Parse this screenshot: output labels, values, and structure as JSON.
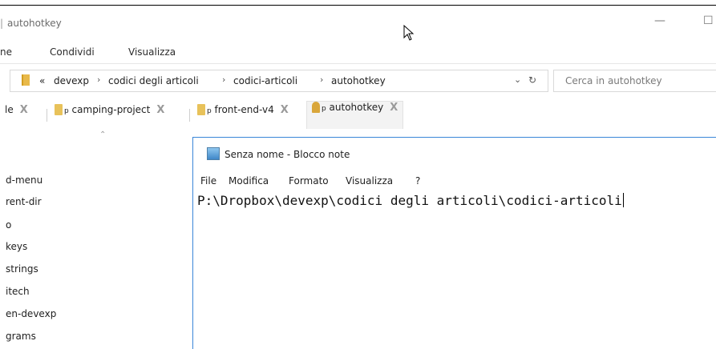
{
  "window": {
    "title": "autohotkey",
    "minimize_icon": "minimize-icon",
    "maximize_icon": "maximize-icon"
  },
  "ribbon": {
    "tabs": [
      "ne",
      "Condividi",
      "Visualizza"
    ]
  },
  "address_bar": {
    "back_glyph": "«",
    "crumbs": [
      "devexp",
      "codici degli articoli",
      "codici-articoli",
      "autohotkey"
    ],
    "dropdown_icon": "chevron-down-icon",
    "refresh_icon": "refresh-icon"
  },
  "search": {
    "placeholder": "Cerca in autohotkey"
  },
  "tabs": [
    {
      "label": "le",
      "close": "X"
    },
    {
      "label": "camping-project",
      "prefix": "p",
      "close": "X"
    },
    {
      "label": "front-end-v4",
      "prefix": "p",
      "close": "X"
    },
    {
      "label": "autohotkey",
      "prefix": "p",
      "close": "X",
      "active": true
    }
  ],
  "sidebar": {
    "items": [
      "d-menu",
      "rent-dir",
      "o",
      "keys",
      "strings",
      "itech",
      "en-devexp",
      "grams"
    ]
  },
  "notepad": {
    "title": "Senza nome - Blocco note",
    "menu": [
      "File",
      "Modifica",
      "Formato",
      "Visualizza",
      "?"
    ],
    "content": "P:\\Dropbox\\devexp\\codici degli articoli\\codici-articoli"
  },
  "colors": {
    "accent_border": "#3a86d8",
    "folder": "#e8c25a"
  }
}
